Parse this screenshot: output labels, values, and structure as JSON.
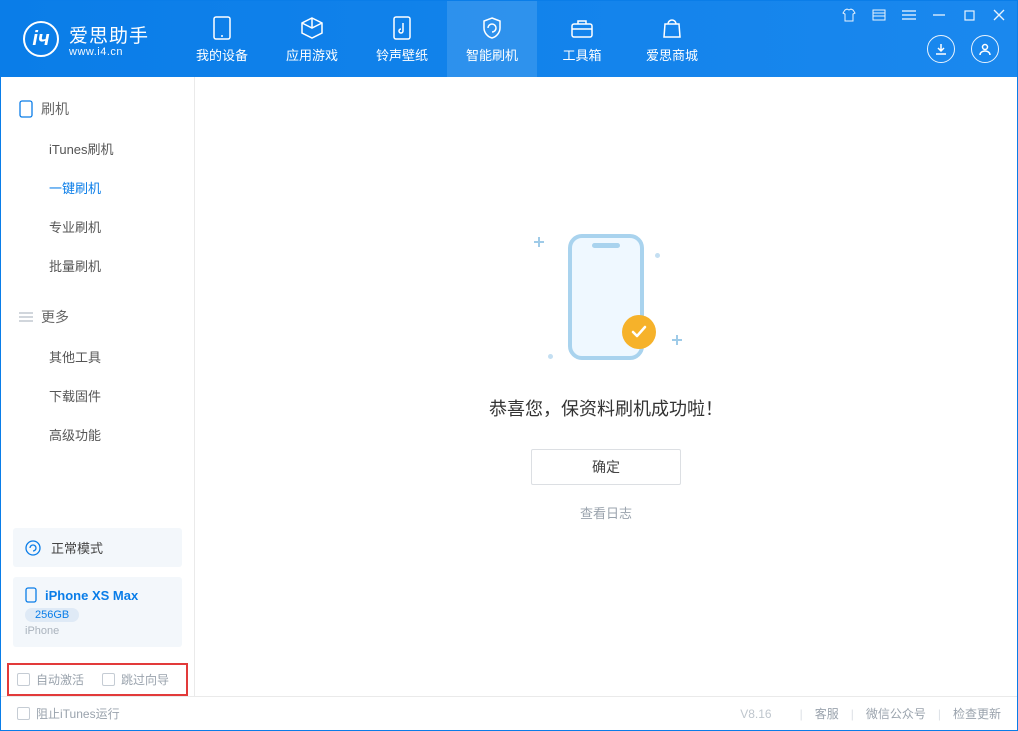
{
  "brand": {
    "name": "爱思助手",
    "url": "www.i4.cn"
  },
  "nav": {
    "my_device": "我的设备",
    "apps": "应用游戏",
    "ringtones": "铃声壁纸",
    "flash": "智能刷机",
    "toolbox": "工具箱",
    "store": "爱思商城"
  },
  "sidebar": {
    "flash_group": "刷机",
    "items": {
      "itunes": "iTunes刷机",
      "oneclick": "一键刷机",
      "pro": "专业刷机",
      "batch": "批量刷机"
    },
    "more_group": "更多",
    "more_items": {
      "other": "其他工具",
      "firmware": "下载固件",
      "advanced": "高级功能"
    }
  },
  "device": {
    "mode": "正常模式",
    "name": "iPhone XS Max",
    "storage": "256GB",
    "type": "iPhone"
  },
  "options": {
    "auto_activate": "自动激活",
    "skip_guide": "跳过向导"
  },
  "main": {
    "success_msg": "恭喜您，保资料刷机成功啦！",
    "confirm": "确定",
    "view_log": "查看日志"
  },
  "statusbar": {
    "block_itunes": "阻止iTunes运行",
    "version": "V8.16",
    "support": "客服",
    "wechat": "微信公众号",
    "check_update": "检查更新"
  }
}
